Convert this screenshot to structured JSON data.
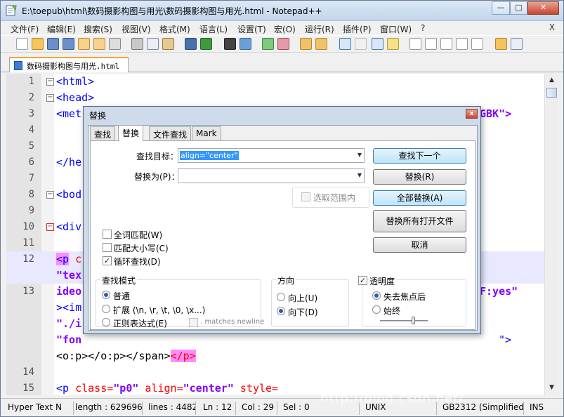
{
  "window": {
    "title": "E:\\toepub\\html\\数码摄影构图与用光\\数码摄影构图与用光.html - Notepad++",
    "controls": [
      "—",
      "□",
      "✕"
    ]
  },
  "menu": {
    "items": [
      "文件(F)",
      "编辑(E)",
      "搜索(S)",
      "视图(V)",
      "格式(M)",
      "语言(L)",
      "设置(T)",
      "宏(O)",
      "运行(R)",
      "插件(P)",
      "窗口(W)",
      "?"
    ],
    "close": "X"
  },
  "tab": {
    "label": "数码摄影构图与用光.html"
  },
  "editor": {
    "lines": [
      {
        "num": "1",
        "fold": "minus"
      },
      {
        "num": "2",
        "fold": "minus"
      },
      {
        "num": "3"
      },
      {
        "num": "4"
      },
      {
        "num": "5"
      },
      {
        "num": "6"
      },
      {
        "num": "7"
      },
      {
        "num": "8",
        "fold": "minus"
      },
      {
        "num": "9"
      },
      {
        "num": "10",
        "fold": "minus-red"
      },
      {
        "num": "11"
      },
      {
        "num": "12"
      },
      {
        "num": "13"
      },
      {
        "num": "14"
      },
      {
        "num": "15"
      }
    ],
    "code": {
      "l1": "<html>",
      "l2": "<head>",
      "l3a": "<met",
      "l3b": "GBK\">",
      "l6": "</he",
      "l8": "<bod",
      "l10": "<div",
      "l12a": "<p",
      "l12b": " c",
      "l12c": "\"tex",
      "l13a": "ideo",
      "l13b": "F:yes\"",
      "l13c": "><im",
      "l13d": "\"./i",
      "l13e": "\"fon",
      "l13f": "\">",
      "l13g": "<o:p></o:p></span>",
      "l13h": "</p>",
      "l15a": "<p",
      "l15b": " class=",
      "l15c": "\"p0\"",
      "l15d": " align=",
      "l15e": "\"center\"",
      "l15f": " style="
    }
  },
  "dialog": {
    "title": "替换",
    "close": "x",
    "tabs": [
      "查找",
      "替换",
      "文件查找",
      "Mark"
    ],
    "find_label": "查找目标：",
    "find_value": "align=\"center\"",
    "replace_label": "替换为(P)：",
    "replace_value": "",
    "in_selection": "选取范围内",
    "buttons": {
      "find_next": "查找下一个",
      "replace": "替换(R)",
      "replace_all": "全部替换(A)",
      "replace_all_open": "替换所有打开文件",
      "cancel": "取消"
    },
    "options": {
      "whole_word": "全词匹配(W)",
      "match_case": "匹配大小写(C)",
      "wrap": "循环查找(D)"
    },
    "search_mode": {
      "title": "查找模式",
      "normal": "普通",
      "extended": "扩展 (\\n, \\r, \\t, \\0, \\x...)",
      "regex": "正则表达式(E)",
      "matches_newline": ". matches newline"
    },
    "direction": {
      "title": "方向",
      "up": "向上(U)",
      "down": "向下(D)"
    },
    "transparency": {
      "title": "透明度",
      "on_lose_focus": "失去焦点后",
      "always": "始终"
    }
  },
  "status": {
    "type": "Hyper Text N",
    "length": "length : 629696",
    "lines": "lines : 4482",
    "ln": "Ln : 12",
    "col": "Col : 29",
    "sel": "Sel : 0",
    "eol": "UNIX",
    "encoding": "GB2312 (Simplified)",
    "mode": "INS"
  },
  "watermark": "http://blog.csdn.net/"
}
